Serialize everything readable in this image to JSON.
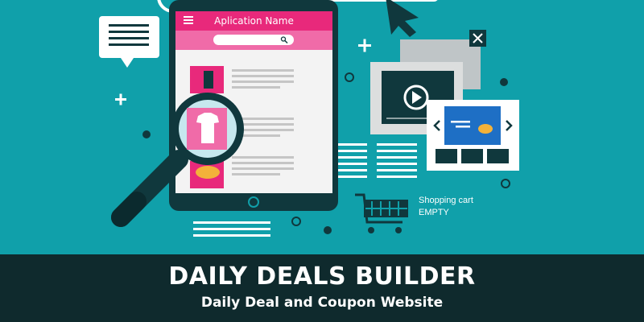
{
  "app": {
    "title": "Aplication Name"
  },
  "cart": {
    "label": "Shopping cart",
    "status": "EMPTY"
  },
  "banner": {
    "title": "DAILY DEALS BUILDER",
    "subtitle": "Daily Deal and Coupon Website"
  }
}
